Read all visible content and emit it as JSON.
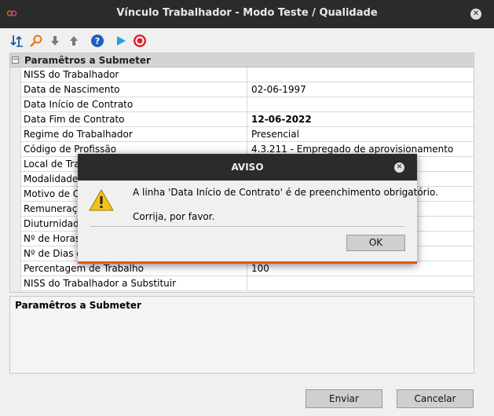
{
  "window": {
    "title": "Vínculo Trabalhador - Modo Teste / Qualidade",
    "close_icon": "close-icon"
  },
  "toolbar": {
    "icons": [
      "sort-icon",
      "search-icon",
      "arrow-down-icon",
      "arrow-up-icon",
      "help-icon",
      "play-icon",
      "stop-icon"
    ]
  },
  "grid": {
    "section_label": "Paramêtros a Submeter",
    "rows": [
      {
        "label": "NISS do Trabalhador",
        "value": ""
      },
      {
        "label": "Data de Nascimento",
        "value": "02-06-1997"
      },
      {
        "label": "Data Início de Contrato",
        "value": ""
      },
      {
        "label": "Data Fim de Contrato",
        "value": "12-06-2022"
      },
      {
        "label": "Regime do Trabalhador",
        "value": "Presencial"
      },
      {
        "label": "Código de Profissão",
        "value": "4.3.211 - Empregado de aprovisionamento"
      },
      {
        "label": "Local de Trabalho",
        "value": ""
      },
      {
        "label": "Modalidade de Contrato",
        "value": ""
      },
      {
        "label": "Motivo de Contratação",
        "value": ""
      },
      {
        "label": "Remuneração Base",
        "value": ""
      },
      {
        "label": "Diuturnidades",
        "value": ""
      },
      {
        "label": "Nº de Horas Semanais",
        "value": ""
      },
      {
        "label": "Nº de Dias de Trabalho",
        "value": ""
      },
      {
        "label": "Percentagem de Trabalho",
        "value": "100"
      },
      {
        "label": "NISS do Trabalhador a Substituir",
        "value": ""
      }
    ]
  },
  "description": {
    "title": "Paramêtros a Submeter"
  },
  "footer": {
    "send_label": "Enviar",
    "cancel_label": "Cancelar"
  },
  "dialog": {
    "title": "AVISO",
    "message": "A linha 'Data Início de Contrato' é de preenchimento obrigatório.",
    "sub_message": "Corrija, por favor.",
    "ok_label": "OK",
    "accent_color": "#e8541a"
  }
}
